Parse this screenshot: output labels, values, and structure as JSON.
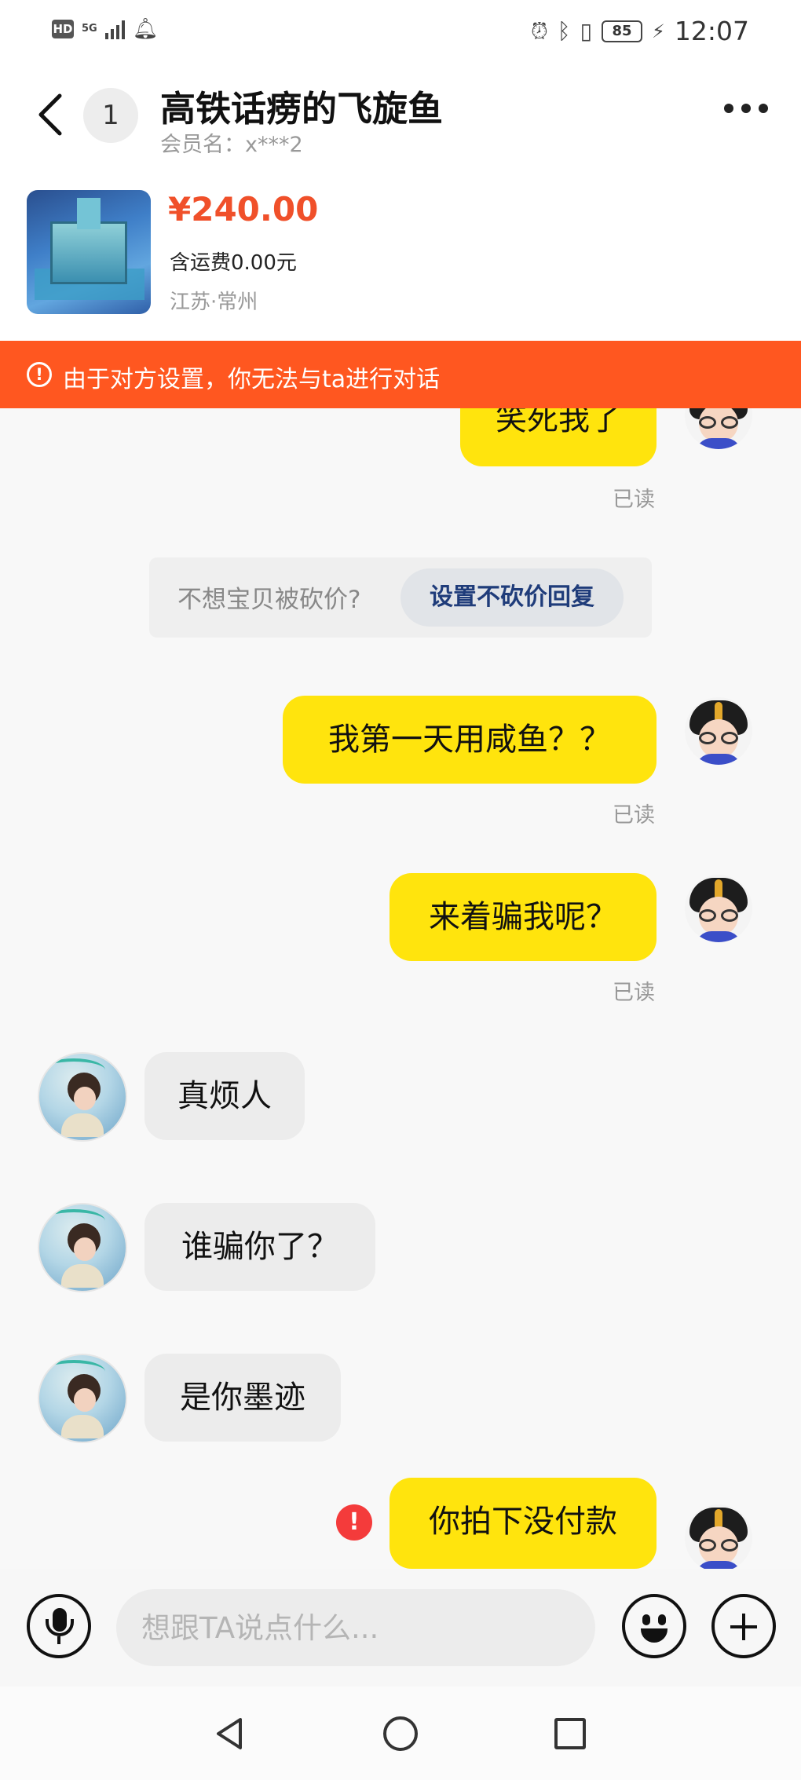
{
  "status_bar": {
    "hd": "HD",
    "network": "5G",
    "battery": "85",
    "time": "12:07"
  },
  "header": {
    "unread_count": "1",
    "title": "高铁话痨的飞旋鱼",
    "member": "会员名：x***2"
  },
  "product": {
    "price": "¥240.00",
    "shipping": "含运费0.00元",
    "location": "江苏·常州"
  },
  "banner": {
    "icon": "!",
    "text": "由于对方设置，你无法与ta进行对话"
  },
  "tip": {
    "text": "不想宝贝被砍价?",
    "button": "设置不砍价回复"
  },
  "messages": [
    {
      "side": "out",
      "text": "笑死我了",
      "status": "已读"
    },
    {
      "side": "out",
      "text": "我第一天用咸鱼？？",
      "status": "已读"
    },
    {
      "side": "out",
      "text": "来着骗我呢？",
      "status": "已读"
    },
    {
      "side": "in",
      "text": "真烦人"
    },
    {
      "side": "in",
      "text": "谁骗你了？"
    },
    {
      "side": "in",
      "text": "是你墨迹"
    },
    {
      "side": "out",
      "text": "你拍下没付款",
      "error": "!"
    }
  ],
  "input": {
    "placeholder": "想跟TA说点什么..."
  },
  "icons": {
    "back": "chevron-left-icon",
    "more": "more-dots-icon",
    "mic": "microphone-icon",
    "emoji": "smiley-icon",
    "plus": "plus-icon"
  },
  "colors": {
    "banner": "#ff5720",
    "price": "#f0502a",
    "outgoing_bubble": "#ffe40d",
    "incoming_bubble": "#ececec",
    "error": "#f43b3b"
  }
}
